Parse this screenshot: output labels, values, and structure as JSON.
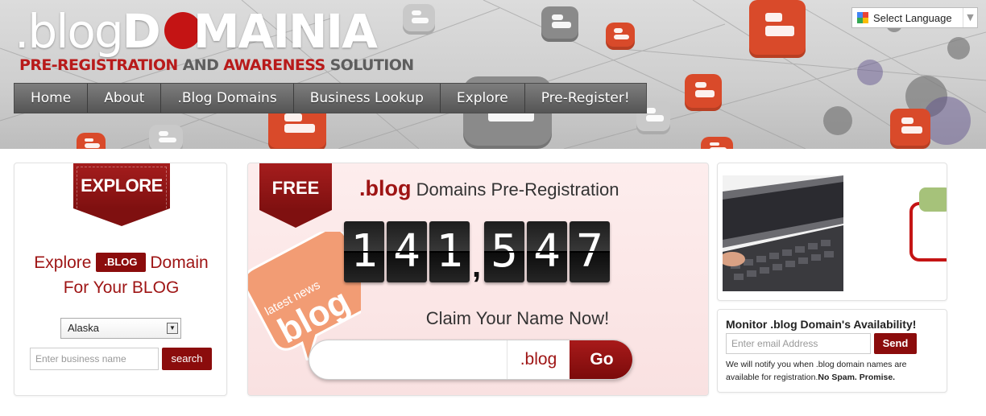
{
  "header": {
    "logo_light": ".blog",
    "logo_d": "D",
    "logo_rest": "MAINIA",
    "tagline": {
      "part1": "PRE-REGISTRATION",
      "part2": " AND ",
      "part3": "AWARENESS",
      "part4": " SOLUTION"
    },
    "nav": [
      "Home",
      "About",
      ".Blog Domains",
      "Business Lookup",
      "Explore",
      "Pre-Register!"
    ],
    "language": {
      "label": "Select Language",
      "arrow": "▼"
    }
  },
  "explore_panel": {
    "ribbon": "EXPLORE",
    "heading_before": "Explore",
    "heading_pill": ".BLOG",
    "heading_after": "Domain",
    "heading_line2": "For Your BLOG",
    "state_value": "Alaska",
    "business_placeholder": "Enter business name",
    "search_label": "search"
  },
  "preregistration_panel": {
    "ribbon": "FREE",
    "title_blog": ".blog",
    "title_rest": " Domains Pre-Registration",
    "bubble_text_top": "latest news",
    "bubble_text_main": "blog",
    "counter": {
      "value": 141547,
      "digits_group1": [
        "1",
        "4",
        "1"
      ],
      "separator": ",",
      "digits_group2": [
        "5",
        "4",
        "7"
      ]
    },
    "claim": "Claim Your Name Now!",
    "domain_ext": ".blog",
    "go_label": "Go"
  },
  "monitor_panel": {
    "title": "Monitor .blog Domain's Availability!",
    "email_placeholder": "Enter email Address",
    "send_label": "Send",
    "notify_text": "We will notify you when .blog domain names are available for registration.",
    "notify_bold": "No Spam. Promise."
  },
  "colors": {
    "brand_red": "#8b0c0c",
    "accent_red": "#c41414",
    "nav_grey": "#555555"
  }
}
